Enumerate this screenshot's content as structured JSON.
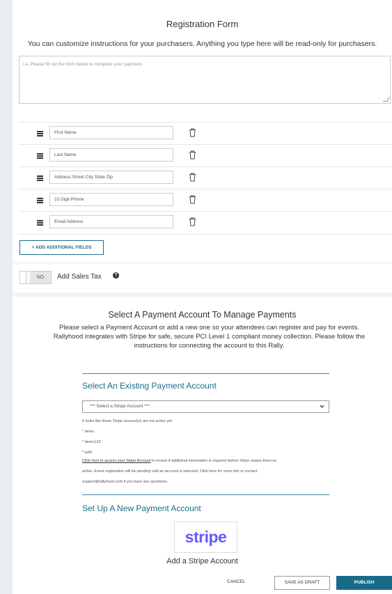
{
  "form": {
    "title": "Registration Form",
    "instructions": "You can customize instructions for your purchasers. Anything you type here will be read-only for purchasers.",
    "textarea_placeholder": "i.e. Please fill out the form below to complete your payment.",
    "fields": [
      {
        "placeholder": "First Name"
      },
      {
        "placeholder": "Last Name"
      },
      {
        "placeholder": "Address Street City State Zip"
      },
      {
        "placeholder": "10 Digit Phone"
      },
      {
        "placeholder": "Email Address"
      }
    ],
    "add_fields_label": "+ ADD ADDITIONAL FIELDS",
    "sales_tax_toggle": "NO",
    "sales_tax_label": "Add Sales Tax",
    "help_icon": "?"
  },
  "payment": {
    "title": "Select A Payment Account To Manage Payments",
    "description": "Please select a Payment Account or add a new one so your attendees can register and pay for events. Rallyhood integrates with Stripe for safe, secure PCI Level 1 compliant money collection. Please follow the instructions for connecting the account to this Rally.",
    "existing_heading": "Select An Existing Payment Account",
    "select_value": "*** Select a Stripe Account ***",
    "inactive_note": "It looks like these Stripe account(s) are not active yet:",
    "inactive_accounts": [
      "* demo",
      "* demo123",
      "* adsf"
    ],
    "link_text": "Click here to access your Stripe Account",
    "link_suffix": " to review if additional information is required before Stripe makes them as",
    "pending_line": "active. Event registration will be pending until an account is selected. Click here for more info or contact",
    "contact_email": "support@rallyhood.com",
    "contact_suffix": " if you have any questions.",
    "new_heading": "Set Up A New Payment Account",
    "stripe_logo": "stripe",
    "add_stripe_label": "Add a Stripe Account"
  },
  "actions": {
    "cancel": "CANCEL",
    "save_draft": "SAVE AS DRAFT",
    "publish": "PUBLISH"
  },
  "colors": {
    "accent": "#1a6b8a",
    "stripe": "#635bff"
  }
}
